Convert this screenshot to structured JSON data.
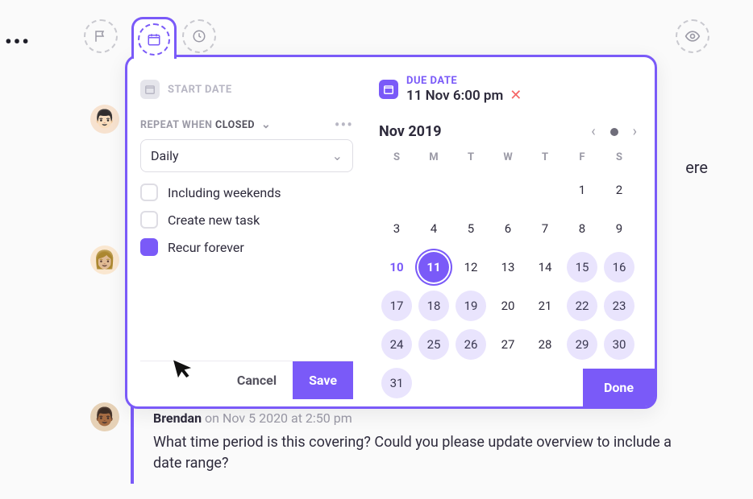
{
  "toolbar": {
    "more": "•••",
    "icons": {
      "flag": "flag-icon",
      "calendar": "calendar-icon",
      "clock": "clock-icon",
      "eye": "eye-icon"
    }
  },
  "popover": {
    "start_label": "START DATE",
    "due_label": "DUE DATE",
    "due_value": "11 Nov  6:00 pm",
    "clear": "✕",
    "repeat_prefix": "REPEAT WHEN ",
    "repeat_state": "CLOSED",
    "repeat_more": "•••",
    "select_value": "Daily",
    "checks": [
      {
        "label": "Including weekends",
        "checked": false
      },
      {
        "label": "Create new task",
        "checked": false
      },
      {
        "label": "Recur forever",
        "checked": true
      }
    ],
    "cancel": "Cancel",
    "save": "Save",
    "done": "Done"
  },
  "calendar": {
    "title": "Nov 2019",
    "dow": [
      "S",
      "M",
      "T",
      "W",
      "T",
      "F",
      "S"
    ],
    "lead_blanks": 5,
    "days": 30,
    "due_day": 10,
    "selected_day": 11,
    "highlight_days": [
      15,
      16,
      17,
      18,
      19,
      22,
      23,
      24,
      25,
      26,
      29,
      30,
      31
    ]
  },
  "comment": {
    "author": "Brendan",
    "meta": "on Nov 5 2020 at 2:50 pm",
    "body": "What time period is this covering? Could you please update overview to include a date range?"
  },
  "bg_text": "ere"
}
